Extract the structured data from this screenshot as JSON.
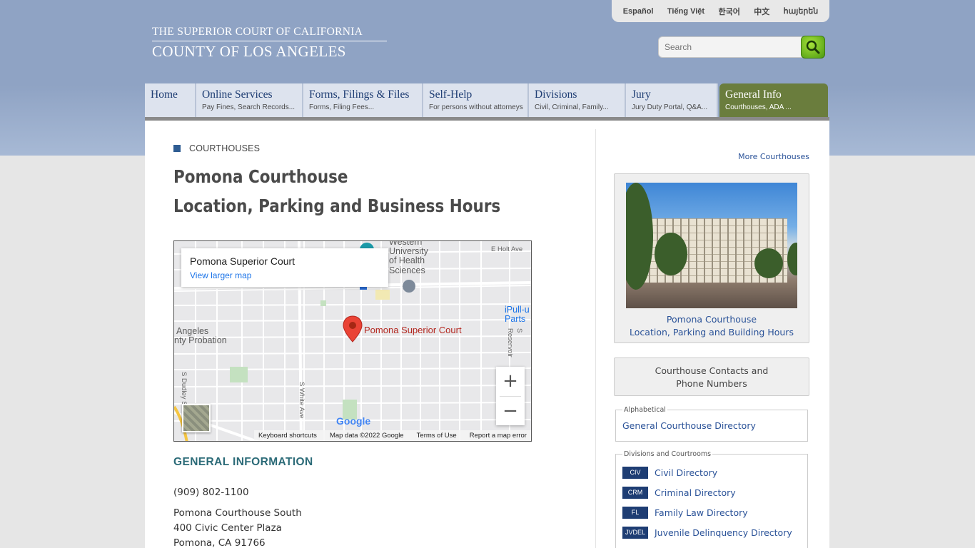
{
  "languages": [
    "Español",
    "Tiếng Việt",
    "한국어",
    "中文",
    "հայերեն"
  ],
  "logo": {
    "line1": "THE SUPERIOR COURT OF CALIFORNIA",
    "line2": "COUNTY OF LOS ANGELES"
  },
  "search": {
    "placeholder": "Search",
    "button_icon": "search-icon"
  },
  "nav": [
    {
      "title": "Home",
      "sub": ""
    },
    {
      "title": "Online Services",
      "sub": "Pay Fines, Search Records..."
    },
    {
      "title": "Forms, Filings & Files",
      "sub": "Forms, Filing Fees..."
    },
    {
      "title": "Self-Help",
      "sub": "For persons without attorneys"
    },
    {
      "title": "Divisions",
      "sub": "Civil, Criminal, Family..."
    },
    {
      "title": "Jury",
      "sub": "Jury Duty Portal, Q&A..."
    },
    {
      "title": "General Info",
      "sub": "Courthouses, ADA ..."
    }
  ],
  "section_label": "COURTHOUSES",
  "page_title": {
    "line1": "Pomona Courthouse",
    "line2": "Location, Parking and Business Hours"
  },
  "map": {
    "card_name": "Pomona Superior Court",
    "card_link": "View larger map",
    "pin_label": "Pomona Superior Court",
    "labels": {
      "western": "Western",
      "university": "University",
      "health": "of Health",
      "sciences": "Sciences",
      "holt": "E Holt Ave",
      "ipull": "iPull-u",
      "parts": "Parts",
      "angeles": "Angeles",
      "probation": "nty Probation",
      "dudley": "S Dudley St",
      "white": "S White Ave",
      "reservoir": "S Reservoir"
    },
    "zoom_in": "+",
    "zoom_out": "−",
    "google": "Google",
    "footer": {
      "shortcuts": "Keyboard shortcuts",
      "data": "Map data ©2022 Google",
      "terms": "Terms of Use",
      "report": "Report a map error"
    }
  },
  "general_info": {
    "heading": "GENERAL INFORMATION",
    "phone": "(909) 802-1100",
    "name": "Pomona Courthouse South",
    "street": "400 Civic Center Plaza",
    "city": "Pomona, CA 91766"
  },
  "sidebar": {
    "more_link": "More Courthouses",
    "photo_caption_1": "Pomona Courthouse",
    "photo_caption_2": "Location, Parking and Building Hours",
    "contacts_1": "Courthouse Contacts and",
    "contacts_2": "Phone Numbers",
    "alpha_legend": "Alphabetical",
    "alpha_link": "General Courthouse Directory",
    "div_legend": "Divisions and Courtrooms",
    "directories": [
      {
        "badge": "CIV",
        "label": "Civil Directory"
      },
      {
        "badge": "CRM",
        "label": "Criminal Directory"
      },
      {
        "badge": "FL",
        "label": "Family Law Directory"
      },
      {
        "badge": "JVDEL",
        "label": "Juvenile Delinquency Directory"
      }
    ]
  },
  "colors": {
    "header_blue": "#8fa3c4",
    "nav_active": "#6a7d3d",
    "link": "#2a5298",
    "heading_teal": "#2c6b78",
    "badge": "#1e3d73"
  }
}
